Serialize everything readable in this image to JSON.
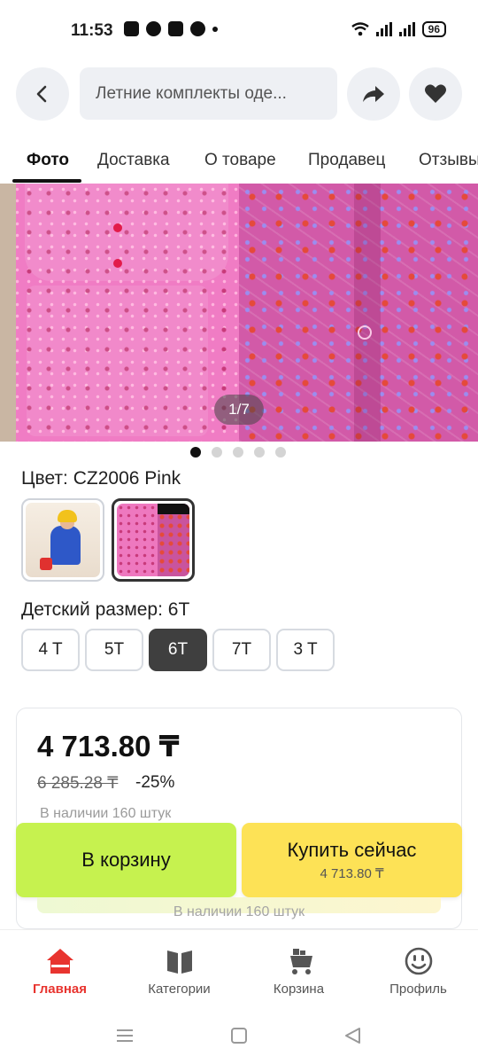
{
  "status": {
    "time": "11:53",
    "battery": "96"
  },
  "header": {
    "search_text": "Летние комплекты оде..."
  },
  "tabs": [
    "Фото",
    "Доставка",
    "О товаре",
    "Продавец",
    "Отзывы"
  ],
  "gallery": {
    "counter": "1/7",
    "dots_total": 5,
    "active_dot": 0
  },
  "color": {
    "label": "Цвет: CZ2006 Pink"
  },
  "size": {
    "label": "Детский размер: 6T",
    "options": [
      "4 T",
      "5T",
      "6T",
      "7T",
      "3 T"
    ],
    "selected": "6T"
  },
  "price": {
    "current": "4 713.80 ₸",
    "old": "6 285.28 ₸",
    "discount": "-25%",
    "stock": "В наличии 160 штук"
  },
  "actions": {
    "cart": "В корзину",
    "buy": "Купить сейчас",
    "buy_price": "4 713.80 ₸",
    "stock": "В наличии 160 штук"
  },
  "nav": [
    {
      "label": "Главная",
      "icon": "home-icon",
      "active": true
    },
    {
      "label": "Категории",
      "icon": "catalog-icon",
      "active": false
    },
    {
      "label": "Корзина",
      "icon": "cart-icon",
      "active": false
    },
    {
      "label": "Профиль",
      "icon": "smile-icon",
      "active": false
    }
  ],
  "colors": {
    "accent_red": "#e8342f",
    "cart_green": "#c6f24f",
    "buy_yellow": "#fde256",
    "selected_size": "#3f3f3f"
  }
}
